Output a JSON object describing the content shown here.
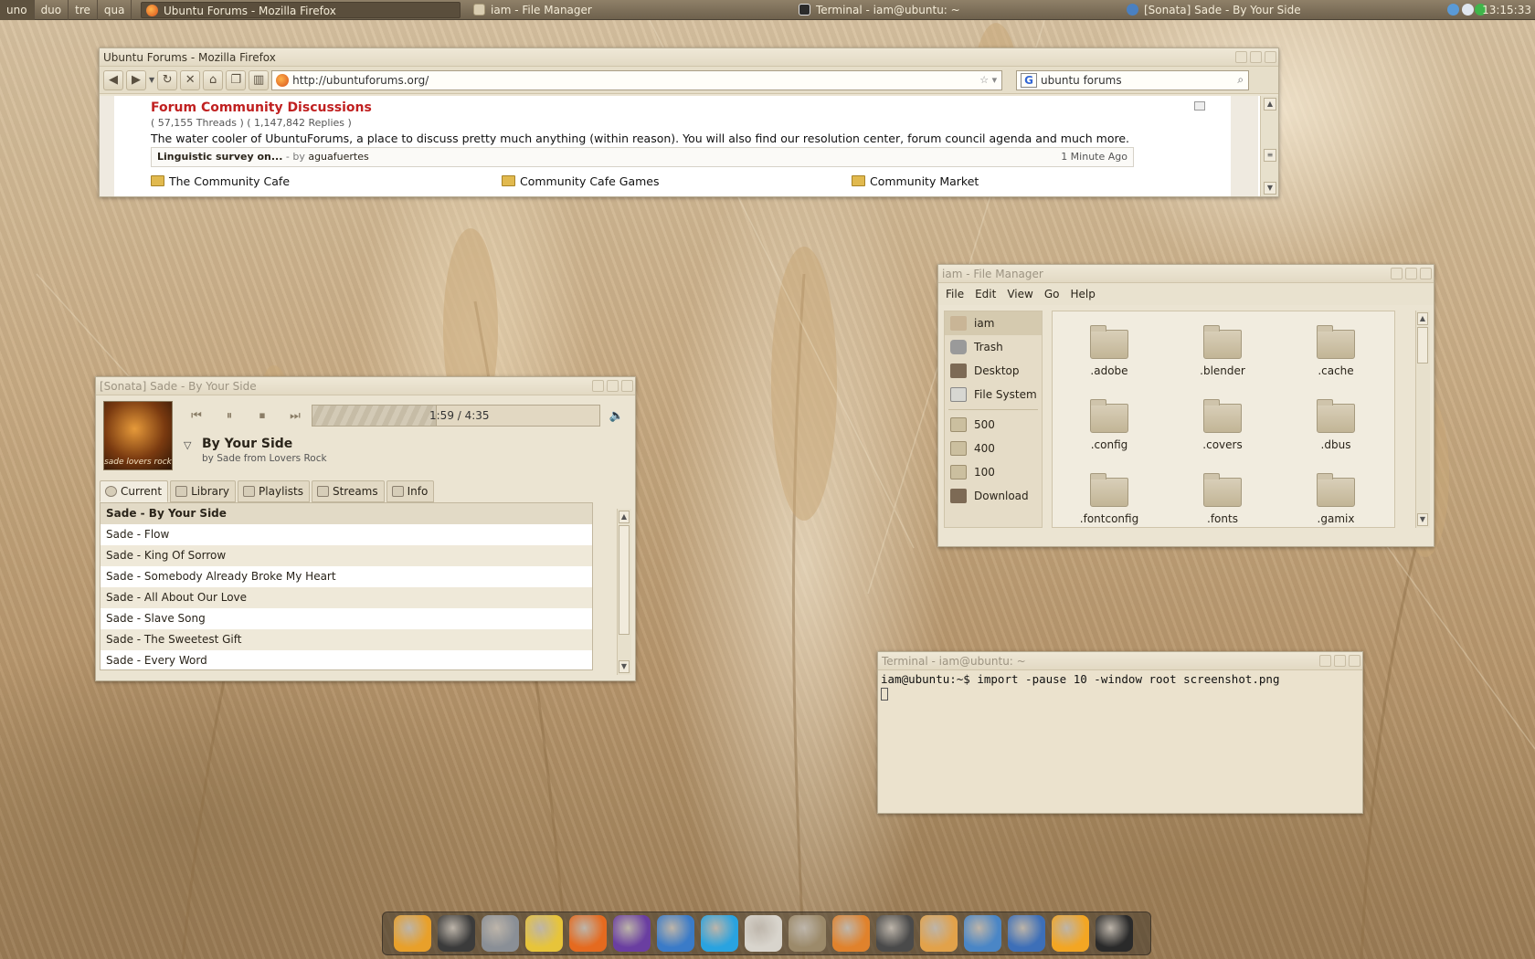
{
  "topPanel": {
    "workspaces": [
      "uno",
      "duo",
      "tre",
      "qua"
    ],
    "tasks": [
      {
        "label": "Ubuntu Forums - Mozilla Firefox",
        "icon": "firefox-icon"
      },
      {
        "label": "iam - File Manager",
        "icon": "folder-icon"
      },
      {
        "label": "Terminal - iam@ubuntu: ~",
        "icon": "terminal-icon"
      },
      {
        "label": "[Sonata] Sade - By Your Side",
        "icon": "sonata-icon"
      }
    ],
    "clock": "13:15:33"
  },
  "firefox": {
    "title": "Ubuntu Forums - Mozilla Firefox",
    "url": "http://ubuntuforums.org/",
    "search_value": "ubuntu forums",
    "search_engine": "G",
    "forum": {
      "title": "Forum Community Discussions",
      "counts": "( 57,155 Threads ) ( 1,147,842 Replies )",
      "description": "The water cooler of UbuntuForums, a place to discuss pretty much anything (within reason). You will also find our resolution center, forum council agenda and much more.",
      "last_post_title": "Linguistic survey on...",
      "last_post_by": " - by ",
      "last_post_author": "aguafuertes",
      "last_post_time": "1 Minute Ago",
      "subforums": [
        "The Community Cafe",
        "Community Cafe Games",
        "Community Market"
      ]
    }
  },
  "fileManager": {
    "title": "iam - File Manager",
    "menu": [
      "File",
      "Edit",
      "View",
      "Go",
      "Help"
    ],
    "places": [
      "iam",
      "Trash",
      "Desktop",
      "File System"
    ],
    "bookmarks": [
      "500",
      "400",
      "100",
      "Download"
    ],
    "folders": [
      ".adobe",
      ".blender",
      ".cache",
      ".config",
      ".covers",
      ".dbus",
      ".fontconfig",
      ".fonts",
      ".gamix"
    ]
  },
  "sonata": {
    "title": "[Sonata] Sade - By Your Side",
    "album_art_caption": "sade lovers rock",
    "time": "1:59 / 4:35",
    "progress_fraction": 0.433,
    "song_title": "By Your Side",
    "song_sub": "by Sade from Lovers Rock",
    "tabs": [
      "Current",
      "Library",
      "Playlists",
      "Streams",
      "Info"
    ],
    "playlist": [
      "Sade - By Your Side",
      "Sade - Flow",
      "Sade - King Of Sorrow",
      "Sade - Somebody Already Broke My Heart",
      "Sade - All About Our Love",
      "Sade - Slave Song",
      "Sade - The Sweetest Gift",
      "Sade - Every Word"
    ]
  },
  "terminal": {
    "title": "Terminal - iam@ubuntu: ~",
    "prompt": "iam@ubuntu:~$ ",
    "command": "import -pause 10 -window root screenshot.png"
  },
  "dock": {
    "icons": [
      "gnome-foot-icon",
      "terminal-icon",
      "network-icon",
      "notes-icon",
      "firefox-icon",
      "pidgin-icon",
      "thunderbird-icon",
      "skype-icon",
      "document-viewer-icon",
      "gimp-icon",
      "blender-icon",
      "inkscape-icon",
      "text-editor-icon",
      "system-monitor-icon",
      "music-player-icon",
      "vlc-icon",
      "disk-icon"
    ],
    "colors": [
      "#e8a02a",
      "#3b3b3b",
      "#8a8f96",
      "#e7c43a",
      "#e56a1f",
      "#6a3ea1",
      "#3a7bc8",
      "#29a3e0",
      "#d8d4cc",
      "#9c8a6a",
      "#e0822c",
      "#4a4a4a",
      "#e2a24a",
      "#4a86c6",
      "#3d6fb8",
      "#f3a623",
      "#2a2a2a"
    ]
  }
}
